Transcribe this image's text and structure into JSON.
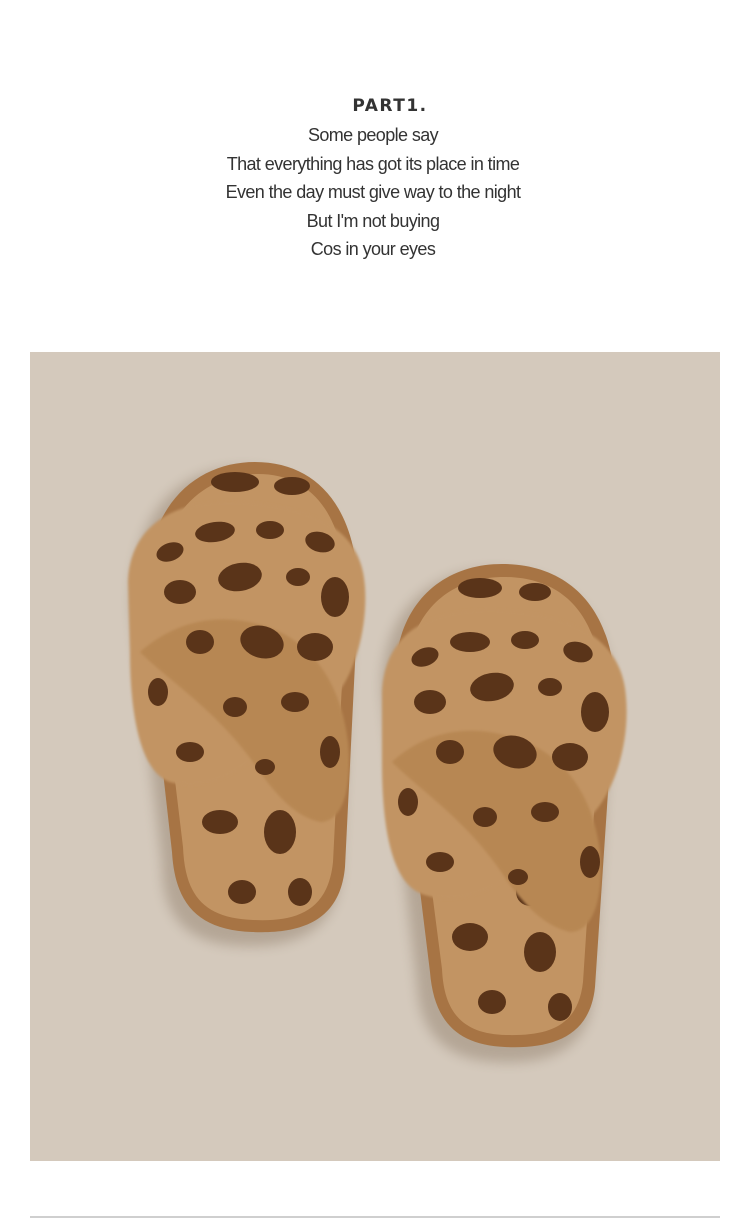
{
  "section": {
    "heading": "PART1.",
    "lines": [
      "Some people say",
      "That everything has got its place in time",
      "Even the day must give way to the night",
      "But I'm not buying",
      "Cos in your eyes"
    ]
  },
  "photo": {
    "subject_icon": "leopard-slippers-icon",
    "background_color": "#d4c9bc",
    "fur_color": "#c29463",
    "spot_color": "#5a3419",
    "sole_color": "#a77444"
  }
}
